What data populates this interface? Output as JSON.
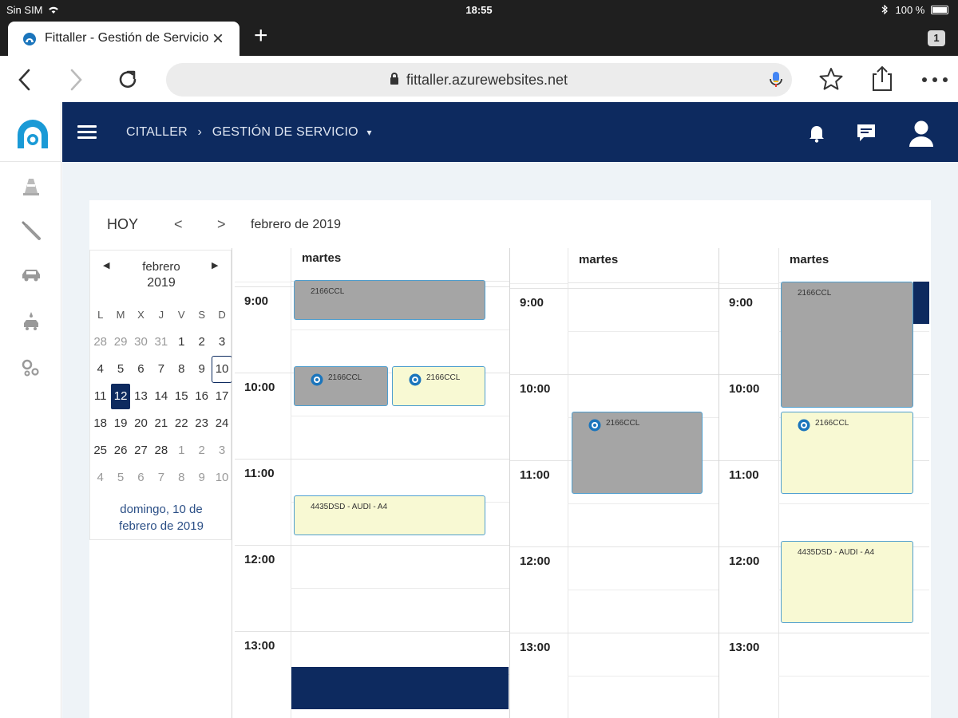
{
  "status_bar": {
    "carrier": "Sin SIM",
    "time": "18:55",
    "battery": "100 %"
  },
  "browser": {
    "tab_title": "Fittaller - Gestión de Servicio",
    "tab_count": "1",
    "url": "fittaller.azurewebsites.net",
    "icons": [
      "back-icon",
      "forward-icon",
      "reload-icon",
      "lock-icon",
      "mic-icon",
      "star-icon",
      "share-icon",
      "more-icon",
      "close-icon",
      "new-tab-icon"
    ]
  },
  "sidebar": {
    "items": [
      {
        "icon": "traffic-cone-icon"
      },
      {
        "icon": "screwdriver-icon"
      },
      {
        "icon": "car-icon"
      },
      {
        "icon": "car-wash-icon"
      },
      {
        "icon": "gears-icon"
      }
    ]
  },
  "header": {
    "crumb1": "CITALLER",
    "crumb_separator": "›",
    "crumb2": "GESTIÓN DE SERVICIO",
    "colors": {
      "navy": "#0d2a5f"
    }
  },
  "calendar": {
    "today_label": "HOY",
    "prev_label": "<",
    "next_label": ">",
    "period": "febrero de 2019",
    "mini": {
      "month": "febrero",
      "year": "2019",
      "weekdays": [
        "L",
        "M",
        "X",
        "J",
        "V",
        "S",
        "D"
      ],
      "weeks": [
        [
          {
            "d": "28",
            "o": true
          },
          {
            "d": "29",
            "o": true
          },
          {
            "d": "30",
            "o": true
          },
          {
            "d": "31",
            "o": true
          },
          {
            "d": "1"
          },
          {
            "d": "2"
          },
          {
            "d": "3"
          }
        ],
        [
          {
            "d": "4"
          },
          {
            "d": "5"
          },
          {
            "d": "6"
          },
          {
            "d": "7"
          },
          {
            "d": "8"
          },
          {
            "d": "9"
          },
          {
            "d": "10",
            "today": true
          }
        ],
        [
          {
            "d": "11"
          },
          {
            "d": "12",
            "selected": true
          },
          {
            "d": "13"
          },
          {
            "d": "14"
          },
          {
            "d": "15"
          },
          {
            "d": "16"
          },
          {
            "d": "17"
          }
        ],
        [
          {
            "d": "18"
          },
          {
            "d": "19"
          },
          {
            "d": "20"
          },
          {
            "d": "21"
          },
          {
            "d": "22"
          },
          {
            "d": "23"
          },
          {
            "d": "24"
          }
        ],
        [
          {
            "d": "25"
          },
          {
            "d": "26"
          },
          {
            "d": "27"
          },
          {
            "d": "28"
          },
          {
            "d": "1",
            "o": true
          },
          {
            "d": "2",
            "o": true
          },
          {
            "d": "3",
            "o": true
          }
        ],
        [
          {
            "d": "4",
            "o": true
          },
          {
            "d": "5",
            "o": true
          },
          {
            "d": "6",
            "o": true
          },
          {
            "d": "7",
            "o": true
          },
          {
            "d": "8",
            "o": true
          },
          {
            "d": "9",
            "o": true
          },
          {
            "d": "10",
            "o": true
          }
        ]
      ],
      "footer_line1": "domingo, 10 de",
      "footer_line2": "febrero de 2019"
    },
    "columns": [
      {
        "day": "martes",
        "hours": [
          "9:00",
          "10:00",
          "11:00",
          "12:00",
          "13:00"
        ]
      },
      {
        "day": "martes",
        "hours": [
          "9:00",
          "10:00",
          "11:00",
          "12:00",
          "13:00"
        ]
      },
      {
        "day": "martes",
        "hours": [
          "9:00",
          "10:00",
          "11:00",
          "12:00",
          "13:00"
        ]
      }
    ],
    "events": {
      "c1_e1": "2166CCL",
      "c1_e2": "2166CCL",
      "c1_e3": "2166CCL",
      "c1_e4": "4435DSD - AUDI - A4",
      "c2_e1": "2166CCL",
      "c3_e1": "2166CCL",
      "c3_e2": "2166CCL",
      "c3_e3": "4435DSD - AUDI - A4"
    }
  }
}
